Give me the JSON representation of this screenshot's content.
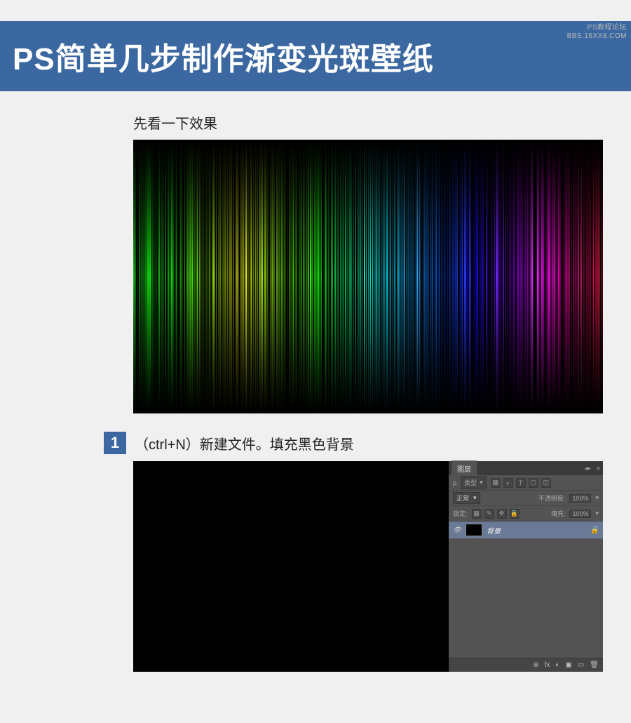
{
  "watermark": {
    "line1": "PS教程论坛",
    "line2": "BBS.16XX8.COM"
  },
  "banner": {
    "title": "PS简单几步制作渐变光斑壁纸"
  },
  "preview": {
    "caption": "先看一下效果"
  },
  "step1": {
    "number": "1",
    "text": "（ctrl+N）新建文件。填充黑色背景"
  },
  "layers_panel": {
    "tab": "图层",
    "menu_icon": "≡",
    "collapse_icon": "◂▸",
    "type_label": "类型",
    "type_dropdown_icon": "▾",
    "filter_icons": [
      "▦",
      "◐",
      "T",
      "▢",
      "◫"
    ],
    "blend_mode": "正常",
    "opacity_label": "不透明度:",
    "opacity_value": "100%",
    "lock_label": "锁定:",
    "fill_label": "填充:",
    "fill_value": "100%",
    "lock_icons": [
      "▦",
      "✎",
      "✥",
      "🔒"
    ],
    "layer": {
      "name": "背景",
      "locked_icon": "🔒",
      "visible_icon": "👁"
    },
    "footer_icons": [
      "⊕",
      "fx",
      "◐",
      "▣",
      "▭",
      "🗑"
    ]
  }
}
